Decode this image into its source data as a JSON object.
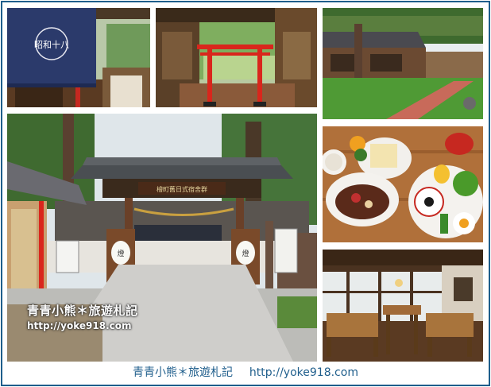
{
  "collage": {
    "photos": [
      {
        "name": "noren-shop-entrance"
      },
      {
        "name": "red-torii-gate"
      },
      {
        "name": "japanese-houses-lawn"
      },
      {
        "name": "shrine-gate-main"
      },
      {
        "name": "japanese-breakfast-set"
      },
      {
        "name": "dining-room-interior"
      }
    ],
    "noren_text": "昭和十八",
    "gate_sign": "檜町舊日式宿舍群",
    "lantern_text": "燈"
  },
  "watermark": {
    "title": "青青小熊＊旅遊札記",
    "url": "http://yoke918.com"
  },
  "footer": {
    "title": "青青小熊＊旅遊札記",
    "url": "http://yoke918.com"
  },
  "colors": {
    "border": "#1f5e8c",
    "torii_red": "#d9261c",
    "wood": "#5a3a22",
    "grass": "#4f9a35"
  }
}
